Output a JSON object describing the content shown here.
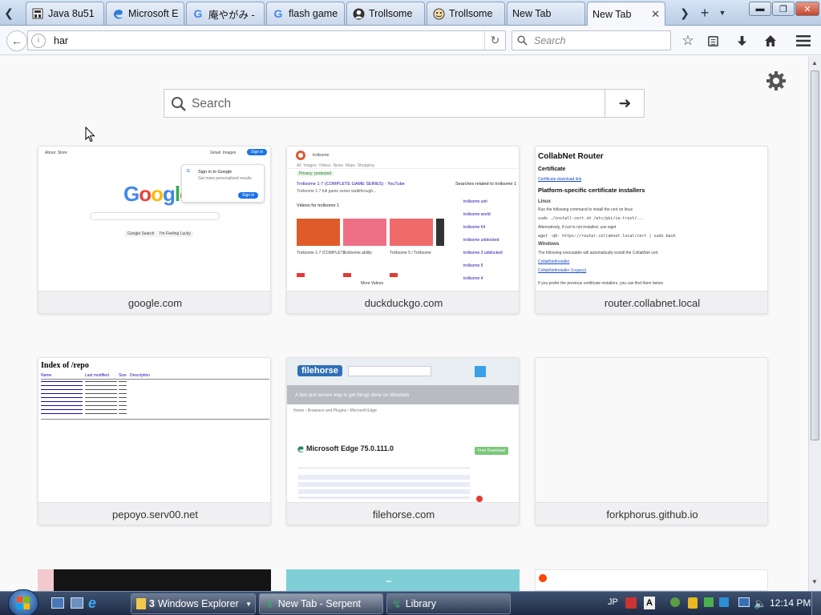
{
  "tabs": [
    {
      "title": "Java 8u51",
      "icon": "document-icon"
    },
    {
      "title": "Microsoft E",
      "icon": "edge-icon"
    },
    {
      "title": "庵やがみ -",
      "icon": "google-icon"
    },
    {
      "title": "flash game",
      "icon": "google-icon"
    },
    {
      "title": "Trollsome",
      "icon": "avatar-icon"
    },
    {
      "title": "Trollsome",
      "icon": "trollface-icon"
    },
    {
      "title": "New Tab",
      "icon": ""
    },
    {
      "title": "New Tab",
      "icon": ""
    }
  ],
  "navbar": {
    "url_value": "har",
    "search_placeholder": "Search"
  },
  "newtab": {
    "search_placeholder": "Search",
    "tiles": [
      {
        "label": "google.com"
      },
      {
        "label": "duckduckgo.com"
      },
      {
        "label": "router.collabnet.local"
      },
      {
        "label": "pepoyo.serv00.net"
      },
      {
        "label": "filehorse.com"
      },
      {
        "label": "forkphorus.github.io"
      }
    ],
    "thumbs": {
      "google": {
        "logo": "Google",
        "signin": "Sign in",
        "popup_title": "Sign in to Google",
        "popup_button": "Sign in",
        "search_btn": "Google Search",
        "lucky_btn": "I'm Feeling Lucky"
      },
      "ddg": {
        "query": "trollsome",
        "result_title": "Trollsome 1-7 (COMPLETE GAME SERIES) - YouTube",
        "section": "Videos for trollsome 1",
        "side_title": "Searches related to trollsome 1",
        "more": "More Videos"
      },
      "router": {
        "title": "CollabNet Router",
        "h_cert": "Certificate",
        "link_cert": "Certificate download link",
        "h_platform": "Platform-specific certificate installers",
        "h_linux": "Linux",
        "h_windows": "Windows",
        "link_installer": "CollabNetInstaller",
        "link_installer2": "CollabNetInstaller (Legacy)"
      },
      "pepoyo": {
        "title": "Index of /repo",
        "col_name": "Name",
        "col_modified": "Last modified",
        "col_size": "Size",
        "col_desc": "Description"
      },
      "filehorse": {
        "logo": "filehorse",
        "banner": "A fast and secure way to get things done on Windows",
        "product": "Microsoft Edge 75.0.111.0",
        "download": "Free Download"
      }
    }
  },
  "taskbar": {
    "tasks": [
      {
        "label": "Windows Explorer",
        "count": "3"
      },
      {
        "label": "New Tab - Serpent"
      },
      {
        "label": "Library"
      }
    ],
    "lang": "JP",
    "clock": "12:14 PM"
  }
}
